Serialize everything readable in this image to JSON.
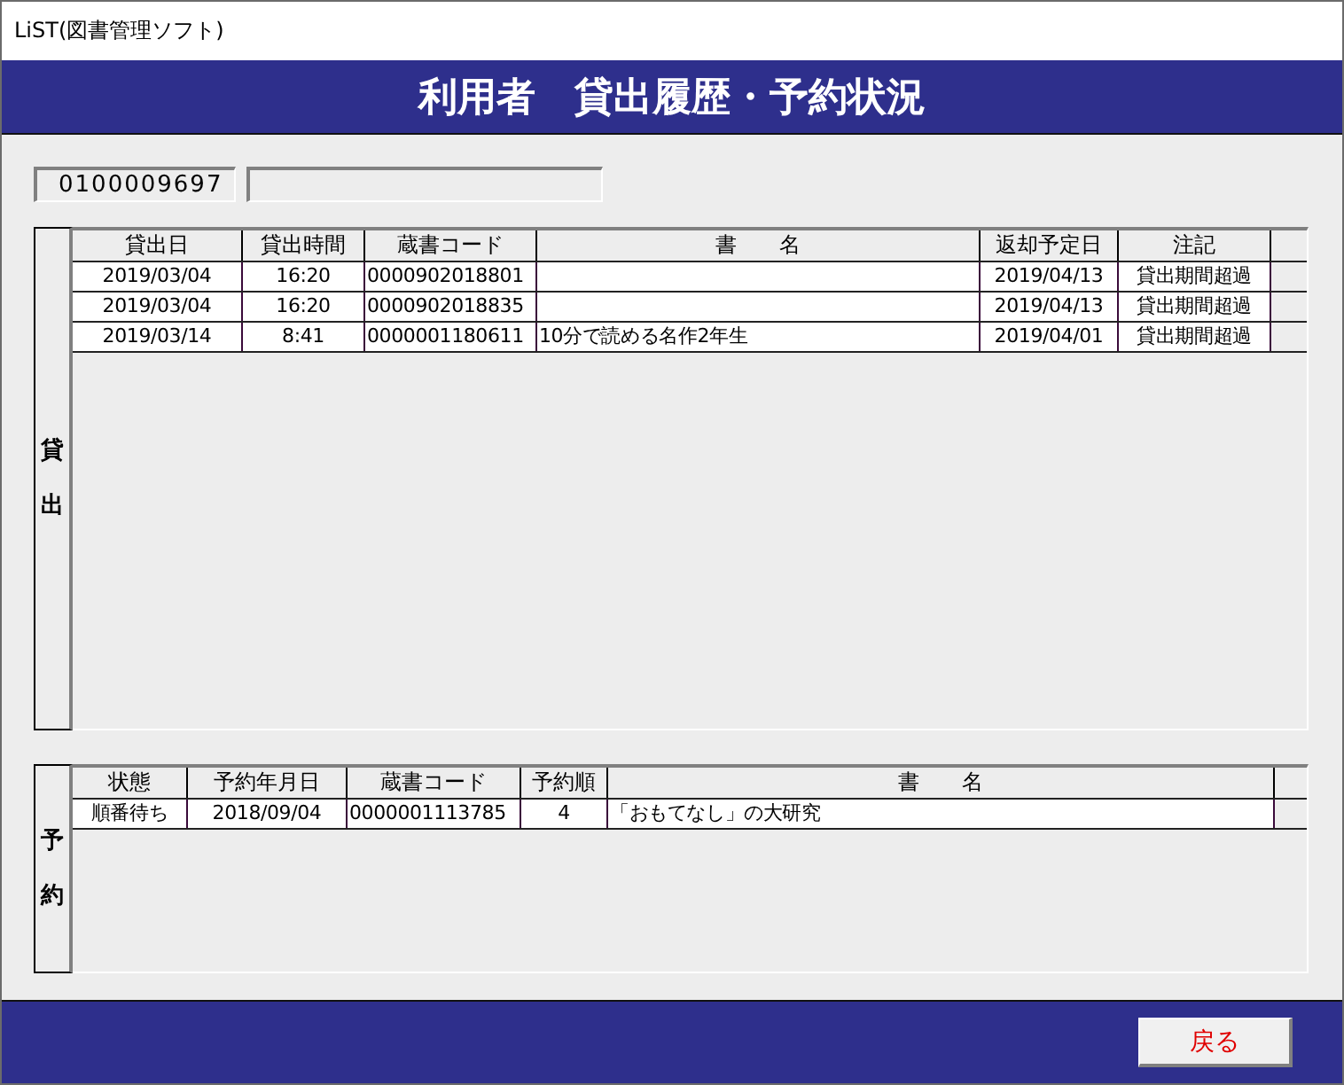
{
  "window": {
    "title": "LiST(図書管理ソフト)"
  },
  "header": {
    "title": "利用者　貸出履歴・予約状況"
  },
  "user": {
    "id": "0100009697"
  },
  "loans": {
    "label": "貸出",
    "columns": [
      "貸出日",
      "貸出時間",
      "蔵書コード",
      "書　　名",
      "返却予定日",
      "注記"
    ],
    "rows": [
      [
        "2019/03/04",
        "16:20",
        "0000902018801",
        null,
        "2019/04/13",
        "貸出期間超過"
      ],
      [
        "2019/03/04",
        "16:20",
        "0000902018835",
        null,
        "2019/04/13",
        "貸出期間超過"
      ],
      [
        "2019/03/14",
        "8:41",
        "0000001180611",
        "10分で読める名作2年生",
        "2019/04/01",
        "貸出期間超過"
      ]
    ]
  },
  "reservations": {
    "label": "予約",
    "columns": [
      "状態",
      "予約年月日",
      "蔵書コード",
      "予約順",
      "書　　名"
    ],
    "rows": [
      [
        "順番待ち",
        "2018/09/04",
        "0000001113785",
        "4",
        "「おもてなし」の大研究"
      ]
    ]
  },
  "buttons": [
    {
      "label": "戻る"
    }
  ]
}
